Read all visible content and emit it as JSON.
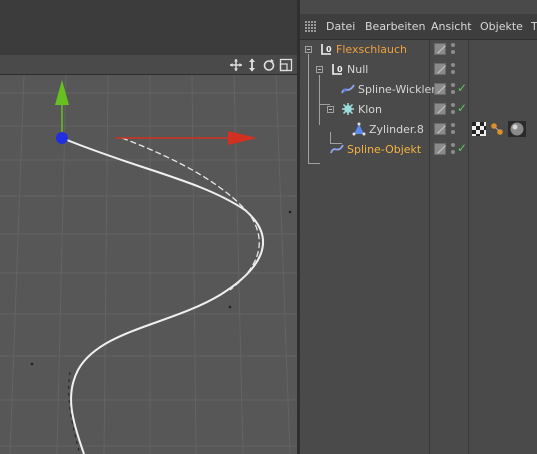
{
  "menubar": {
    "items": [
      "Datei",
      "Bearbeiten",
      "Ansicht",
      "Objekte",
      "T"
    ]
  },
  "objects": [
    {
      "name": "Flexschlauch",
      "icon": "null-object-icon",
      "enabled": false
    },
    {
      "name": "Null",
      "icon": "null-object-icon",
      "enabled": false
    },
    {
      "name": "Spline-Wickler",
      "icon": "spline-wrap-icon",
      "enabled": true
    },
    {
      "name": "Klon",
      "icon": "cloner-icon",
      "enabled": true
    },
    {
      "name": "Zylinder.8",
      "icon": "cylinder-icon",
      "enabled": false,
      "tags": [
        "checker-material-icon",
        "phong-tag-icon",
        "sphere-material-icon"
      ]
    },
    {
      "name": "Spline-Objekt",
      "icon": "spline-icon",
      "enabled": true
    }
  ],
  "viewport": {
    "toolbar_icons": [
      "move-view-icon",
      "zoom-view-icon",
      "rotate-view-icon",
      "maximize-view-icon"
    ]
  },
  "colors": {
    "highlight_orange": "#f0a040",
    "check_green": "#5ec85e",
    "axis_y": "#66c020",
    "axis_x": "#d43020",
    "pivot": "#2030e0"
  }
}
